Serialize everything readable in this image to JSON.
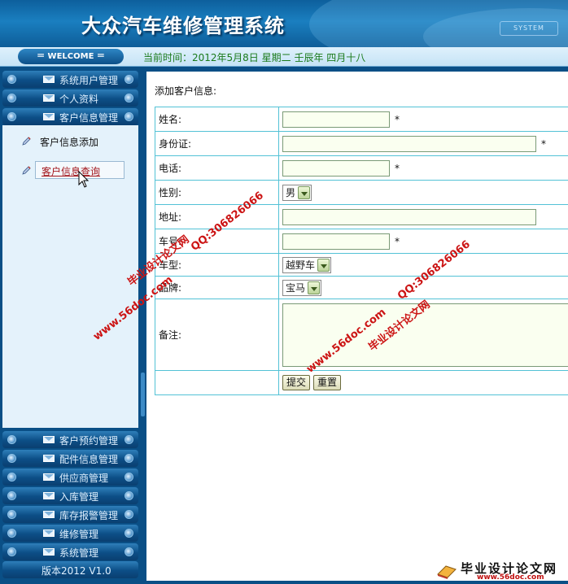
{
  "header": {
    "title": "大众汽车维修管理系统",
    "system_tag": "SYSTEM",
    "welcome": "＝ WELCOME ＝",
    "current_time": "当前时间：2012年5月8日  星期二  壬辰年  四月十八"
  },
  "sidebar": {
    "top_menus": [
      {
        "label": "系统用户管理"
      },
      {
        "label": "个人资料"
      },
      {
        "label": "客户信息管理"
      }
    ],
    "submenu": [
      {
        "label": "客户信息添加",
        "active": false
      },
      {
        "label": "客户信息查询",
        "active": true
      }
    ],
    "bottom_menus": [
      {
        "label": "客户预约管理"
      },
      {
        "label": "配件信息管理"
      },
      {
        "label": "供应商管理"
      },
      {
        "label": "入库管理"
      },
      {
        "label": "库存报警管理"
      },
      {
        "label": "维修管理"
      },
      {
        "label": "系统管理"
      }
    ],
    "version": "版本2012 V1.0"
  },
  "form": {
    "page_title": "添加客户信息:",
    "required_mark": "*",
    "fields": {
      "name": {
        "label": "姓名:",
        "value": ""
      },
      "id_card": {
        "label": "身份证:",
        "value": ""
      },
      "phone": {
        "label": "电话:",
        "value": ""
      },
      "gender": {
        "label": "性别:",
        "selected": "男"
      },
      "address": {
        "label": "地址:",
        "value": ""
      },
      "plate": {
        "label": "车号:",
        "value": ""
      },
      "car_type": {
        "label": "车型:",
        "selected": "越野车"
      },
      "brand": {
        "label": "品牌:",
        "selected": "宝马"
      },
      "remark": {
        "label": "备注:",
        "value": ""
      }
    },
    "buttons": {
      "submit": "提交",
      "reset": "重置"
    }
  },
  "watermarks": {
    "site_cn": "毕业设计论文网",
    "url": "www.56doc.com",
    "qq": "QQ:306826066"
  },
  "footer_logo": {
    "big": "毕业设计论文网",
    "small": "www.56doc.com"
  },
  "colors": {
    "brand_blue": "#0a4f86",
    "table_border": "#53c2d6",
    "active_link": "#a2141a",
    "time_text": "#1a7a1a",
    "watermark": "#cc1414"
  }
}
